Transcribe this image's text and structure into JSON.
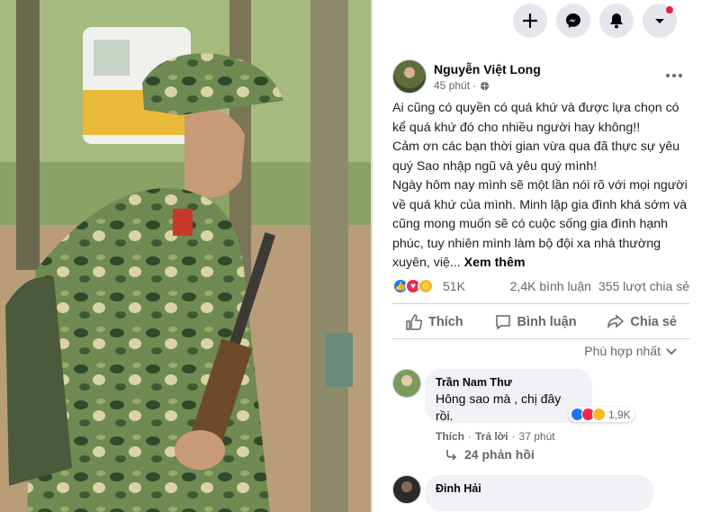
{
  "topbar": {
    "create_icon": "plus-icon",
    "messenger_icon": "messenger-icon",
    "notifications_icon": "bell-icon",
    "account_icon": "caret-down-icon"
  },
  "post": {
    "author": "Nguyễn Việt Long",
    "time": "45 phút ·",
    "text": "Ai cũng có quyền có quá khứ và được lựa chọn có kể quá khứ đó cho nhiều người hay không!!\nCảm ơn các bạn thời gian vừa qua đã thực sự yêu quý Sao nhập ngũ và yêu quý mình!\nNgày hôm nay mình sẽ một lần nói rõ với mọi người về quá khứ của mình. Minh lập gia đình khá sớm và cũng mong muốn sẽ có cuộc sống gia đình hạnh phúc, tuy nhiên mình làm bộ đội xa nhà thường xuyên, việ... ",
    "see_more": "Xem thêm",
    "reaction_count": "51K",
    "comment_count": "2,4K bình luận",
    "share_count": "355 lượt chia sẻ"
  },
  "actions": {
    "like": "Thích",
    "comment": "Bình luận",
    "share": "Chia sẻ"
  },
  "comments": {
    "sort_label": "Phù hợp nhất",
    "items": [
      {
        "name": "Trần Nam Thư",
        "text": "Hông sao mà , chị đây\nrồi.",
        "reaction_count": "1,9K",
        "like_label": "Thích",
        "reply_label": "Trả lời",
        "time": "37 phút"
      },
      {
        "name": "Đinh Hải"
      }
    ],
    "replies_label": "24 phản hồi"
  },
  "colors": {
    "like_blue": "#1877f2",
    "love_red": "#f02849",
    "secondary_text": "#65676b",
    "bubble_bg": "#f0f2f5"
  }
}
